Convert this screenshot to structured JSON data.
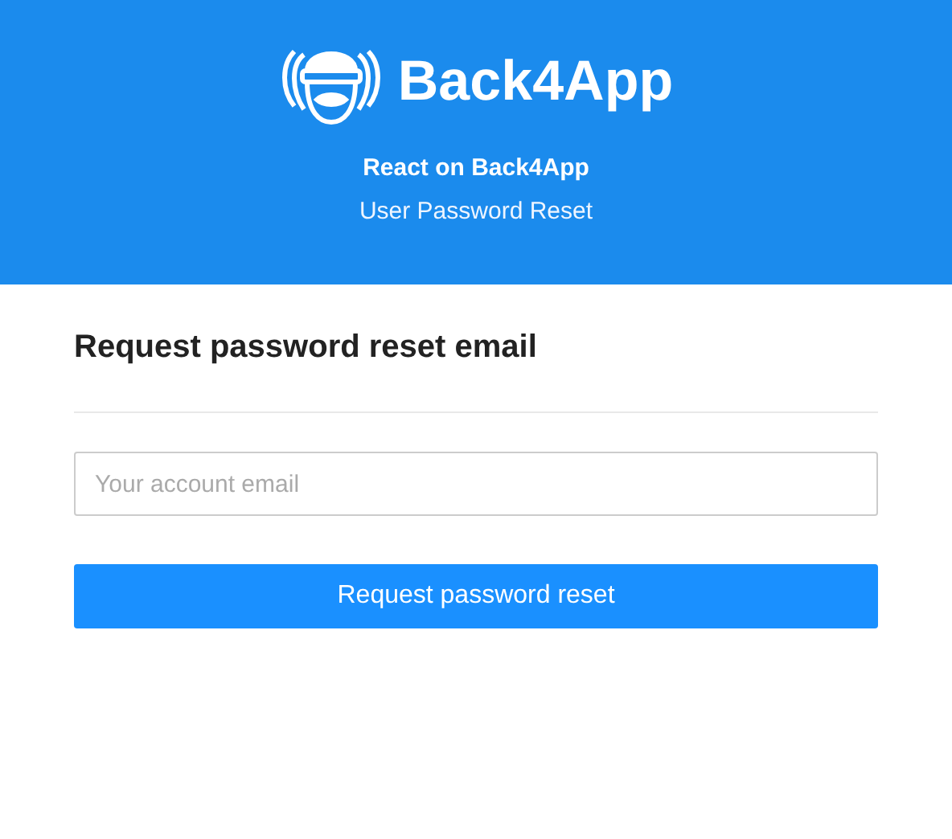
{
  "header": {
    "brand": "Back4App",
    "title": "React on Back4App",
    "subtitle": "User Password Reset"
  },
  "form": {
    "heading": "Request password reset email",
    "email": {
      "placeholder": "Your account email"
    },
    "submit": "Request password reset"
  }
}
